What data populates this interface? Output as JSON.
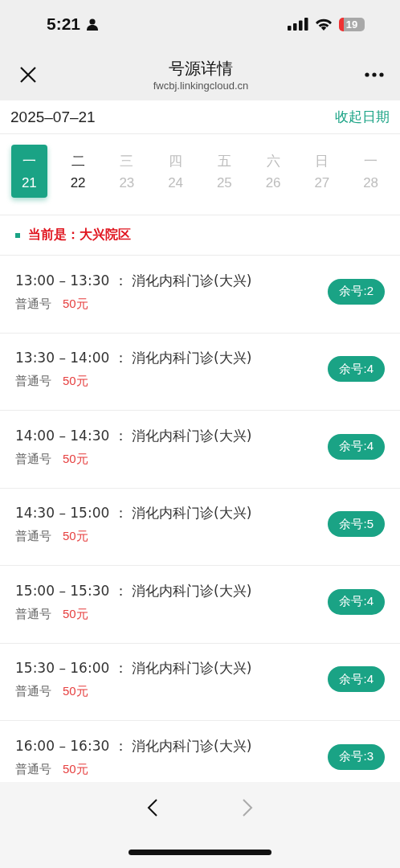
{
  "status_bar": {
    "time": "5:21",
    "battery": "19"
  },
  "nav": {
    "title": "号源详情",
    "subtitle": "fwcbj.linkingcloud.cn"
  },
  "date_bar": {
    "date": "2025–07–21",
    "toggle": "收起日期"
  },
  "days": [
    {
      "weekday": "一",
      "day": "21",
      "selected": true,
      "disabled": false
    },
    {
      "weekday": "二",
      "day": "22",
      "selected": false,
      "disabled": false
    },
    {
      "weekday": "三",
      "day": "23",
      "selected": false,
      "disabled": true
    },
    {
      "weekday": "四",
      "day": "24",
      "selected": false,
      "disabled": true
    },
    {
      "weekday": "五",
      "day": "25",
      "selected": false,
      "disabled": true
    },
    {
      "weekday": "六",
      "day": "26",
      "selected": false,
      "disabled": true
    },
    {
      "weekday": "日",
      "day": "27",
      "selected": false,
      "disabled": true
    },
    {
      "weekday": "一",
      "day": "28",
      "selected": false,
      "disabled": true
    }
  ],
  "campus": "当前是：大兴院区",
  "slots": [
    {
      "time": "13:00 – 13:30 ：",
      "department": "消化内科门诊(大兴)",
      "type": "普通号",
      "price": "50元",
      "remaining": "余号:2"
    },
    {
      "time": "13:30 – 14:00 ：",
      "department": "消化内科门诊(大兴)",
      "type": "普通号",
      "price": "50元",
      "remaining": "余号:4"
    },
    {
      "time": "14:00 – 14:30 ：",
      "department": "消化内科门诊(大兴)",
      "type": "普通号",
      "price": "50元",
      "remaining": "余号:4"
    },
    {
      "time": "14:30 – 15:00 ：",
      "department": "消化内科门诊(大兴)",
      "type": "普通号",
      "price": "50元",
      "remaining": "余号:5"
    },
    {
      "time": "15:00 – 15:30 ：",
      "department": "消化内科门诊(大兴)",
      "type": "普通号",
      "price": "50元",
      "remaining": "余号:4"
    },
    {
      "time": "15:30 – 16:00 ：",
      "department": "消化内科门诊(大兴)",
      "type": "普通号",
      "price": "50元",
      "remaining": "余号:4"
    },
    {
      "time": "16:00 – 16:30 ：",
      "department": "消化内科门诊(大兴)",
      "type": "普通号",
      "price": "50元",
      "remaining": "余号:3"
    }
  ],
  "browser_nav": {
    "back_disabled": false,
    "forward_disabled": true
  }
}
